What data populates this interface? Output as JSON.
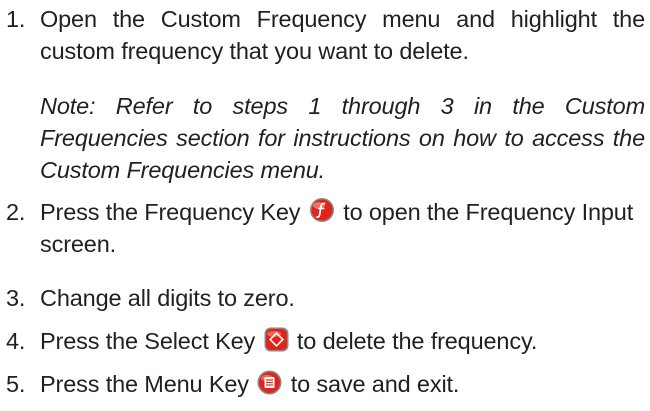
{
  "steps": [
    {
      "number": "1.",
      "text": "Open the Custom Frequency menu and highlight the custom frequency that you want to delete."
    },
    {
      "number": "2.",
      "text_before": "Press the Frequency Key",
      "icon": "frequency-key-icon",
      "text_after": "to open the Frequency Input screen."
    },
    {
      "number": "3.",
      "text": "Change all digits to zero."
    },
    {
      "number": "4.",
      "text_before": "Press the Select Key",
      "icon": "select-key-icon",
      "text_after": "to delete the frequency."
    },
    {
      "number": "5.",
      "text_before": "Press the Menu Key",
      "icon": "menu-key-icon",
      "text_after": "to save and exit."
    }
  ],
  "note": "Note: Refer to steps 1 through 3 in the Custom Frequencies section for instructions on how to access the Custom Frequencies menu.",
  "colors": {
    "text": "#231f20",
    "key_red": "#e2231a"
  }
}
